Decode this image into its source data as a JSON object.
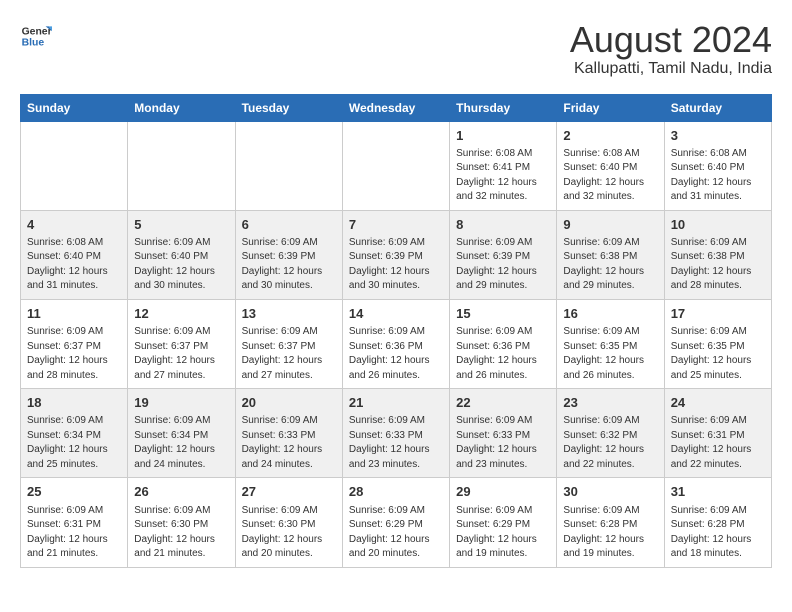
{
  "header": {
    "logo_line1": "General",
    "logo_line2": "Blue",
    "title": "August 2024",
    "subtitle": "Kallupatti, Tamil Nadu, India"
  },
  "calendar": {
    "days_of_week": [
      "Sunday",
      "Monday",
      "Tuesday",
      "Wednesday",
      "Thursday",
      "Friday",
      "Saturday"
    ],
    "weeks": [
      [
        {
          "day": "",
          "detail": ""
        },
        {
          "day": "",
          "detail": ""
        },
        {
          "day": "",
          "detail": ""
        },
        {
          "day": "",
          "detail": ""
        },
        {
          "day": "1",
          "detail": "Sunrise: 6:08 AM\nSunset: 6:41 PM\nDaylight: 12 hours\nand 32 minutes."
        },
        {
          "day": "2",
          "detail": "Sunrise: 6:08 AM\nSunset: 6:40 PM\nDaylight: 12 hours\nand 32 minutes."
        },
        {
          "day": "3",
          "detail": "Sunrise: 6:08 AM\nSunset: 6:40 PM\nDaylight: 12 hours\nand 31 minutes."
        }
      ],
      [
        {
          "day": "4",
          "detail": "Sunrise: 6:08 AM\nSunset: 6:40 PM\nDaylight: 12 hours\nand 31 minutes."
        },
        {
          "day": "5",
          "detail": "Sunrise: 6:09 AM\nSunset: 6:40 PM\nDaylight: 12 hours\nand 30 minutes."
        },
        {
          "day": "6",
          "detail": "Sunrise: 6:09 AM\nSunset: 6:39 PM\nDaylight: 12 hours\nand 30 minutes."
        },
        {
          "day": "7",
          "detail": "Sunrise: 6:09 AM\nSunset: 6:39 PM\nDaylight: 12 hours\nand 30 minutes."
        },
        {
          "day": "8",
          "detail": "Sunrise: 6:09 AM\nSunset: 6:39 PM\nDaylight: 12 hours\nand 29 minutes."
        },
        {
          "day": "9",
          "detail": "Sunrise: 6:09 AM\nSunset: 6:38 PM\nDaylight: 12 hours\nand 29 minutes."
        },
        {
          "day": "10",
          "detail": "Sunrise: 6:09 AM\nSunset: 6:38 PM\nDaylight: 12 hours\nand 28 minutes."
        }
      ],
      [
        {
          "day": "11",
          "detail": "Sunrise: 6:09 AM\nSunset: 6:37 PM\nDaylight: 12 hours\nand 28 minutes."
        },
        {
          "day": "12",
          "detail": "Sunrise: 6:09 AM\nSunset: 6:37 PM\nDaylight: 12 hours\nand 27 minutes."
        },
        {
          "day": "13",
          "detail": "Sunrise: 6:09 AM\nSunset: 6:37 PM\nDaylight: 12 hours\nand 27 minutes."
        },
        {
          "day": "14",
          "detail": "Sunrise: 6:09 AM\nSunset: 6:36 PM\nDaylight: 12 hours\nand 26 minutes."
        },
        {
          "day": "15",
          "detail": "Sunrise: 6:09 AM\nSunset: 6:36 PM\nDaylight: 12 hours\nand 26 minutes."
        },
        {
          "day": "16",
          "detail": "Sunrise: 6:09 AM\nSunset: 6:35 PM\nDaylight: 12 hours\nand 26 minutes."
        },
        {
          "day": "17",
          "detail": "Sunrise: 6:09 AM\nSunset: 6:35 PM\nDaylight: 12 hours\nand 25 minutes."
        }
      ],
      [
        {
          "day": "18",
          "detail": "Sunrise: 6:09 AM\nSunset: 6:34 PM\nDaylight: 12 hours\nand 25 minutes."
        },
        {
          "day": "19",
          "detail": "Sunrise: 6:09 AM\nSunset: 6:34 PM\nDaylight: 12 hours\nand 24 minutes."
        },
        {
          "day": "20",
          "detail": "Sunrise: 6:09 AM\nSunset: 6:33 PM\nDaylight: 12 hours\nand 24 minutes."
        },
        {
          "day": "21",
          "detail": "Sunrise: 6:09 AM\nSunset: 6:33 PM\nDaylight: 12 hours\nand 23 minutes."
        },
        {
          "day": "22",
          "detail": "Sunrise: 6:09 AM\nSunset: 6:33 PM\nDaylight: 12 hours\nand 23 minutes."
        },
        {
          "day": "23",
          "detail": "Sunrise: 6:09 AM\nSunset: 6:32 PM\nDaylight: 12 hours\nand 22 minutes."
        },
        {
          "day": "24",
          "detail": "Sunrise: 6:09 AM\nSunset: 6:31 PM\nDaylight: 12 hours\nand 22 minutes."
        }
      ],
      [
        {
          "day": "25",
          "detail": "Sunrise: 6:09 AM\nSunset: 6:31 PM\nDaylight: 12 hours\nand 21 minutes."
        },
        {
          "day": "26",
          "detail": "Sunrise: 6:09 AM\nSunset: 6:30 PM\nDaylight: 12 hours\nand 21 minutes."
        },
        {
          "day": "27",
          "detail": "Sunrise: 6:09 AM\nSunset: 6:30 PM\nDaylight: 12 hours\nand 20 minutes."
        },
        {
          "day": "28",
          "detail": "Sunrise: 6:09 AM\nSunset: 6:29 PM\nDaylight: 12 hours\nand 20 minutes."
        },
        {
          "day": "29",
          "detail": "Sunrise: 6:09 AM\nSunset: 6:29 PM\nDaylight: 12 hours\nand 19 minutes."
        },
        {
          "day": "30",
          "detail": "Sunrise: 6:09 AM\nSunset: 6:28 PM\nDaylight: 12 hours\nand 19 minutes."
        },
        {
          "day": "31",
          "detail": "Sunrise: 6:09 AM\nSunset: 6:28 PM\nDaylight: 12 hours\nand 18 minutes."
        }
      ]
    ]
  }
}
